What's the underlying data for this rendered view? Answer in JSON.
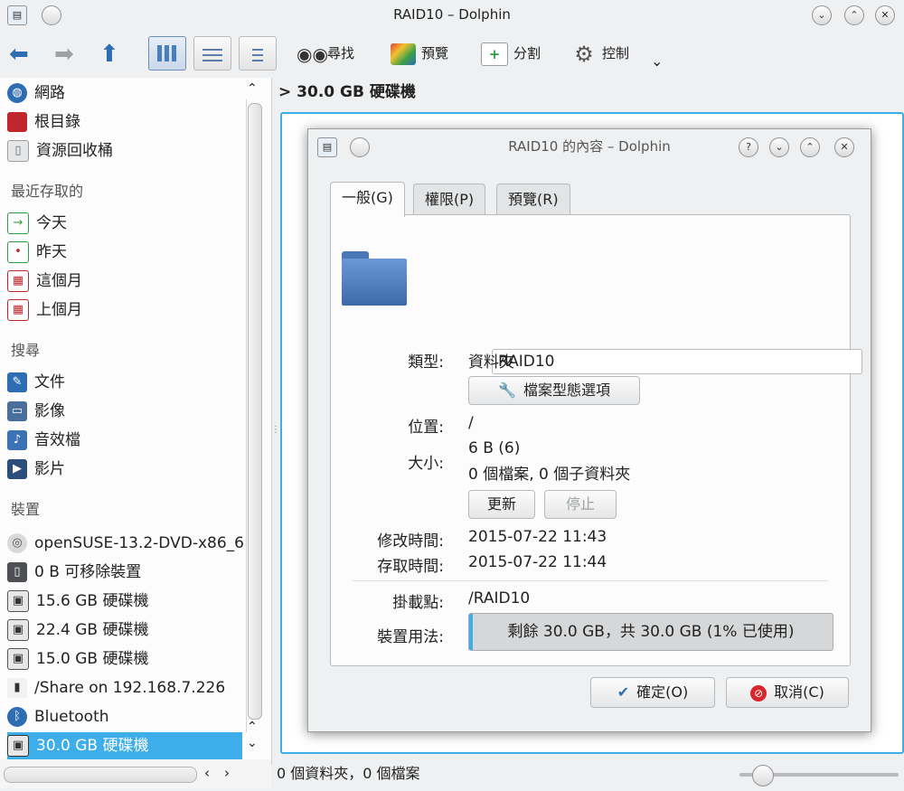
{
  "window": {
    "title": "RAID10 – Dolphin"
  },
  "toolbar": {
    "find": "尋找",
    "preview": "預覽",
    "split": "分割",
    "control": "控制",
    "chevron": "⌄"
  },
  "sidebar": {
    "places": [
      {
        "label": "網路",
        "icon": "network-icon",
        "color": "#2f6db2"
      },
      {
        "label": "根目錄",
        "icon": "root-folder-icon",
        "color": "#c0262c"
      },
      {
        "label": "資源回收桶",
        "icon": "trash-icon",
        "color": "#8c8f92"
      }
    ],
    "recent_head": "最近存取的",
    "recent": [
      {
        "label": "今天",
        "icon": "calendar-today-icon"
      },
      {
        "label": "昨天",
        "icon": "calendar-yesterday-icon"
      },
      {
        "label": "這個月",
        "icon": "calendar-month-icon"
      },
      {
        "label": "上個月",
        "icon": "calendar-last-month-icon"
      }
    ],
    "search_head": "搜尋",
    "search": [
      {
        "label": "文件",
        "icon": "documents-icon"
      },
      {
        "label": "影像",
        "icon": "images-icon"
      },
      {
        "label": "音效檔",
        "icon": "audio-icon"
      },
      {
        "label": "影片",
        "icon": "video-icon"
      }
    ],
    "devices_head": "裝置",
    "devices": [
      {
        "label": "openSUSE-13.2-DVD-x86_6",
        "icon": "optical-disc-icon"
      },
      {
        "label": "0 B 可移除裝置",
        "icon": "removable-drive-icon"
      },
      {
        "label": "15.6 GB 硬碟機",
        "icon": "hard-drive-icon"
      },
      {
        "label": "22.4 GB 硬碟機",
        "icon": "hard-drive-icon"
      },
      {
        "label": "15.0 GB 硬碟機",
        "icon": "hard-drive-icon"
      },
      {
        "label": "/Share on 192.168.7.226",
        "icon": "network-share-icon"
      },
      {
        "label": "Bluetooth",
        "icon": "bluetooth-icon"
      },
      {
        "label": "30.0 GB 硬碟機",
        "icon": "hard-drive-icon",
        "selected": true
      }
    ]
  },
  "breadcrumb": {
    "arrow": ">",
    "label": "30.0 GB 硬碟機"
  },
  "status": {
    "text": "0 個資料夾，0 個檔案"
  },
  "dialog": {
    "title": "RAID10 的內容 – Dolphin",
    "tabs": [
      "一般(G)",
      "權限(P)",
      "預覽(R)"
    ],
    "name_value": "RAID10",
    "type_label": "類型:",
    "type_value": "資料夾",
    "filetype_button": "檔案型態選項",
    "location_label": "位置:",
    "location_value": "/",
    "size_label": "大小:",
    "size_value": "6 B (6)",
    "size_detail": "0 個檔案, 0 個子資料夾",
    "refresh_button": "更新",
    "stop_button": "停止",
    "modified_label": "修改時間:",
    "modified_value": "2015-07-22 11:43",
    "accessed_label": "存取時間:",
    "accessed_value": "2015-07-22 11:44",
    "mount_label": "掛載點:",
    "mount_value": "/RAID10",
    "usage_label": "裝置用法:",
    "usage_value": "剩餘 30.0 GB，共 30.0 GB (1% 已使用)",
    "usage_fraction": 0.01,
    "ok_button": "確定(O)",
    "cancel_button": "取消(C)"
  },
  "colors": {
    "accent": "#3daee9",
    "folder": "#5b86c6"
  }
}
